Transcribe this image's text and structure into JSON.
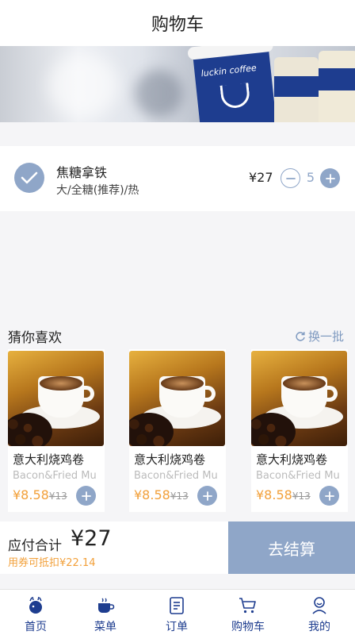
{
  "header": {
    "title": "购物车"
  },
  "banner": {
    "brand_text": "luckin coffee"
  },
  "cart": {
    "item": {
      "name": "焦糖拿铁",
      "spec": "大/全糖(推荐)/热",
      "price": "¥27",
      "quantity": "5"
    }
  },
  "recommend": {
    "title": "猜你喜欢",
    "refresh_label": "换一批",
    "products": [
      {
        "name": "意大利烧鸡卷",
        "en_name": "Bacon&Fried Mu",
        "price": "¥8.58",
        "old_price": "¥13"
      },
      {
        "name": "意大利烧鸡卷",
        "en_name": "Bacon&Fried Mu",
        "price": "¥8.58",
        "old_price": "¥13"
      },
      {
        "name": "意大利烧鸡卷",
        "en_name": "Bacon&Fried Mu",
        "price": "¥8.58",
        "old_price": "¥13"
      }
    ]
  },
  "checkout": {
    "total_label": "应付合计",
    "total_value": "¥27",
    "coupon_text": "用券可抵扣¥22.14",
    "button_label": "去结算"
  },
  "tabbar": {
    "items": [
      {
        "label": "首页",
        "icon": "home-icon"
      },
      {
        "label": "菜单",
        "icon": "coffee-cup-icon"
      },
      {
        "label": "订单",
        "icon": "order-list-icon"
      },
      {
        "label": "购物车",
        "icon": "shopping-cart-icon"
      },
      {
        "label": "我的",
        "icon": "user-icon"
      }
    ]
  },
  "colors": {
    "accent": "#8fa6c8",
    "brand_blue": "#1e3d8f",
    "price_orange": "#f2a03a"
  }
}
